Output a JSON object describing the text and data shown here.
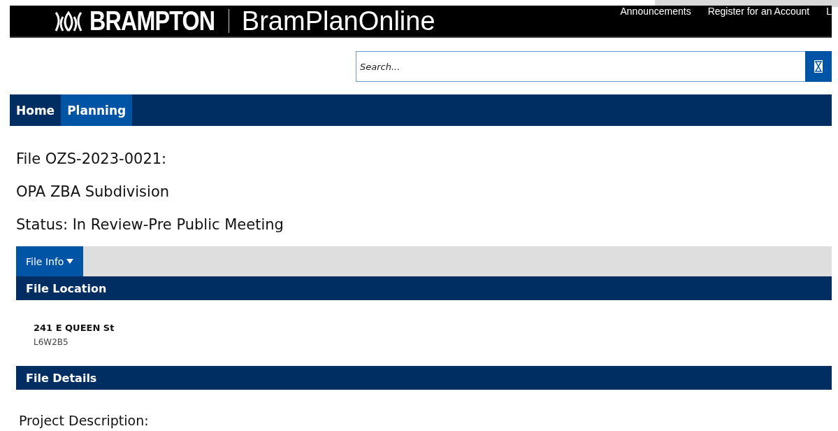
{
  "header": {
    "brand": "BRAMPTON",
    "app_name": "BramPlanOnline",
    "links": [
      "Announcements",
      "Register for an Account",
      "L"
    ]
  },
  "search": {
    "placeholder": "Search..."
  },
  "nav": [
    {
      "label": "Home",
      "selected": false
    },
    {
      "label": "Planning",
      "selected": true
    }
  ],
  "titles": [
    "File OZS-2023-0021:",
    "OPA ZBA Subdivision",
    "Status: In Review-Pre Public Meeting"
  ],
  "tabs": [
    {
      "label": "File Info",
      "selected": true
    }
  ],
  "file_location": {
    "heading": "File Location",
    "street": "241 E QUEEN St",
    "postal": "L6W2B5"
  },
  "file_details": {
    "heading": "File Details",
    "label": "Project Description:"
  }
}
